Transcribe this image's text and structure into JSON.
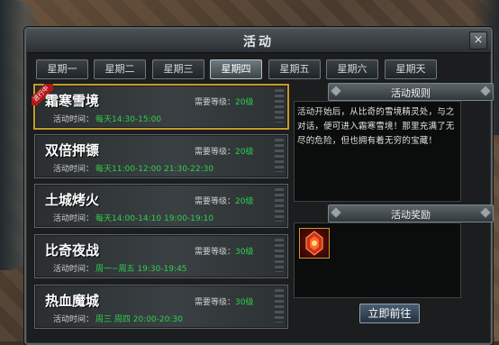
{
  "window": {
    "title": "活动",
    "close_label": "×"
  },
  "tabs": [
    {
      "label": "星期一",
      "active": false
    },
    {
      "label": "星期二",
      "active": false
    },
    {
      "label": "星期三",
      "active": false
    },
    {
      "label": "星期四",
      "active": true
    },
    {
      "label": "星期五",
      "active": false
    },
    {
      "label": "星期六",
      "active": false
    },
    {
      "label": "星期天",
      "active": false
    }
  ],
  "activities": [
    {
      "name": "霜寒雪境",
      "level_label": "需要等级：",
      "level": "20级",
      "time_label": "活动时间：",
      "time": "每天14:30-15:00",
      "badge": "进行中",
      "selected": true
    },
    {
      "name": "双倍押镖",
      "level_label": "需要等级：",
      "level": "20级",
      "time_label": "活动时间：",
      "time": "每天11:00-12:00 21:30-22:30",
      "selected": false
    },
    {
      "name": "土城烤火",
      "level_label": "需要等级：",
      "level": "20级",
      "time_label": "活动时间：",
      "time": "每天14:00-14:10 19:00-19:10",
      "selected": false
    },
    {
      "name": "比奇夜战",
      "level_label": "需要等级：",
      "level": "30级",
      "time_label": "活动时间：",
      "time": "周一~周五 19:30-19:45",
      "selected": false
    },
    {
      "name": "热血魔城",
      "level_label": "需要等级：",
      "level": "30级",
      "time_label": "活动时间：",
      "time": "周三 周四 20:00-20:30",
      "selected": false
    }
  ],
  "rules": {
    "title": "活动规则",
    "text": "活动开始后，从比奇的雪境精灵处，与之对话，便可进入霜寒雪境！那里充满了无尽的危险，但也拥有着无穷的宝藏！"
  },
  "rewards": {
    "title": "活动奖励",
    "items": [
      {
        "icon": "red-crystal-icon"
      }
    ]
  },
  "go_button": {
    "label": "立即前往"
  },
  "colors": {
    "level_green": "#2fd04a",
    "selected_border": "#c79a2a",
    "badge_red": "#b01818"
  }
}
